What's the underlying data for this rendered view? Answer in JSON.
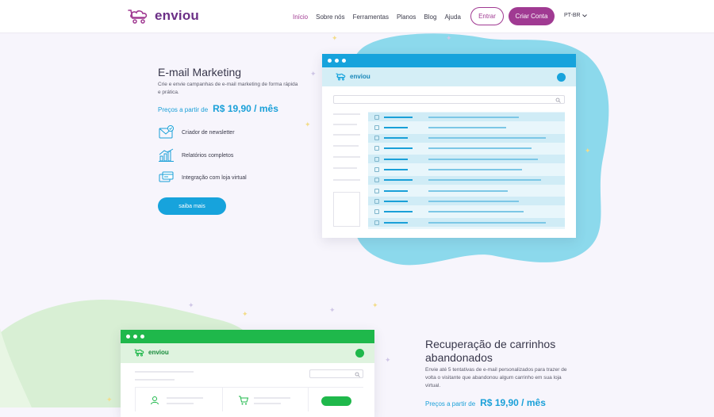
{
  "header": {
    "logo_text": "enviou",
    "nav": [
      "Início",
      "Sobre nós",
      "Ferramentas",
      "Planos",
      "Blog",
      "Ajuda"
    ],
    "login_label": "Entrar",
    "signup_label": "Criar Conta",
    "language": "PT-BR"
  },
  "section1": {
    "title": "E-mail Marketing",
    "description": "Crie e envie campanhas de e-mail marketing de forma rápida e prática.",
    "price_label": "Preços a partir de",
    "price_value": "R$ 19,90 / mês",
    "features": [
      "Criador de newsletter",
      "Relatórios completos",
      "Integração com loja virtual"
    ],
    "cta_label": "saiba mais",
    "mock_logo": "enviou"
  },
  "section2": {
    "title": "Recuperação de carrinhos abandonados",
    "description": "Envie até 5 tentativas de e-mail personalizados para trazer de volta o visitante que abandonou algum carrinho em sua loja virtual.",
    "price_label": "Preços a partir de",
    "price_value": "R$ 19,90 / mês",
    "mock_logo": "enviou"
  },
  "colors": {
    "brand_purple": "#a03a92",
    "accent_blue": "#17a3dc",
    "accent_green": "#1fb84b"
  }
}
